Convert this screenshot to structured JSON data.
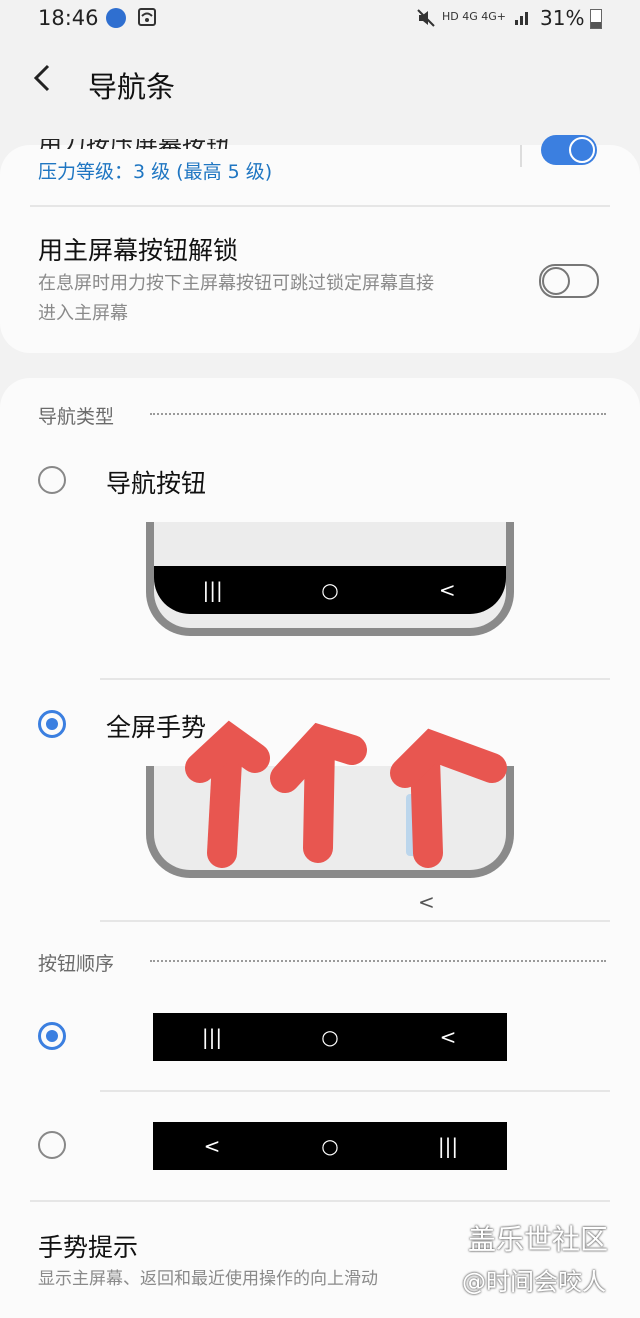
{
  "status_bar": {
    "time": "18:46",
    "network_labels": "HD 4G 4G+",
    "battery": "31%"
  },
  "header": {
    "title": "导航条"
  },
  "pressure_setting": {
    "partial_label": "用力按压屏幕按钮",
    "sub": "压力等级：3 级 (最高 5 级)",
    "enabled": true
  },
  "unlock_setting": {
    "title": "用主屏幕按钮解锁",
    "desc_line1": "在息屏时用力按下主屏幕按钮可跳过锁定屏幕直接",
    "desc_line2": "进入主屏幕",
    "enabled": false
  },
  "nav_type": {
    "section": "导航类型",
    "option_buttons": "导航按钮",
    "option_gesture": "全屏手势",
    "selected": "全屏手势"
  },
  "button_order": {
    "section": "按钮顺序",
    "order_a": [
      "|||",
      "○",
      "<"
    ],
    "order_b": [
      "<",
      "○",
      "|||"
    ],
    "selected": "order_a"
  },
  "gesture_hint": {
    "title": "手势提示",
    "desc": "显示主屏幕、返回和最近使用操作的向上滑动"
  },
  "watermark": {
    "line1": "盖乐世社区",
    "line2": "@时间会咬人"
  },
  "icons": {
    "back": "chevron-left-icon",
    "recent": "recents-icon",
    "home": "home-icon",
    "nav_back": "back-icon"
  },
  "colors": {
    "accent": "#3b7fe0",
    "annotation": "#e85650"
  }
}
